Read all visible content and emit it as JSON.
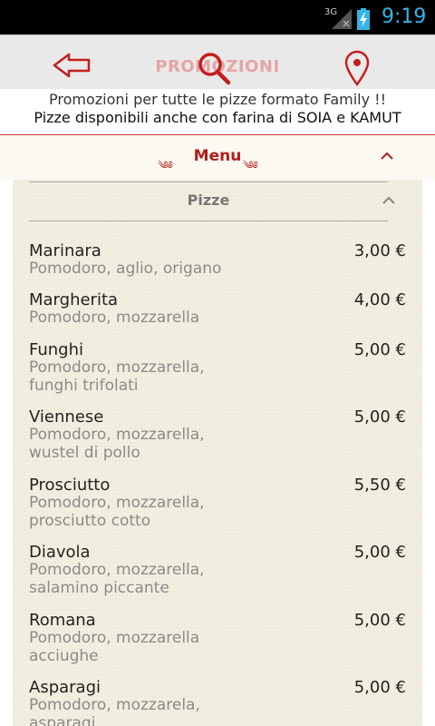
{
  "status_bar": {
    "network": "3G",
    "time": "9:19"
  },
  "action_bar": {
    "title": "PROMOZIONI"
  },
  "promo": {
    "line1": "Promozioni per tutte le pizze formato Family !!",
    "line2": "Pizze disponibili anche con farina di SOIA e KAMUT"
  },
  "menu": {
    "label": "Menu"
  },
  "section": {
    "label": "Pizze"
  },
  "items": [
    {
      "name": "Marinara",
      "desc": "Pomodoro, aglio, origano",
      "price": "3,00 €"
    },
    {
      "name": "Margherita",
      "desc": "Pomodoro, mozzarella",
      "price": "4,00 €"
    },
    {
      "name": "Funghi",
      "desc": "Pomodoro, mozzarella, funghi trifolati",
      "price": "5,00 €"
    },
    {
      "name": "Viennese",
      "desc": "Pomodoro, mozzarella, wustel di pollo",
      "price": "5,00 €"
    },
    {
      "name": "Prosciutto",
      "desc": "Pomodoro, mozzarella, prosciutto cotto",
      "price": "5,50 €"
    },
    {
      "name": "Diavola",
      "desc": "Pomodoro, mozzarella, salamino piccante",
      "price": "5,00 €"
    },
    {
      "name": "Romana",
      "desc": "Pomodoro, mozzarella acciughe",
      "price": "5,00 €"
    },
    {
      "name": "Asparagi",
      "desc": "Pomodoro, mozzarela, asparagi",
      "price": "5,00 €"
    }
  ],
  "colors": {
    "accent": "#b21c1c",
    "status_time": "#33b5e5"
  }
}
